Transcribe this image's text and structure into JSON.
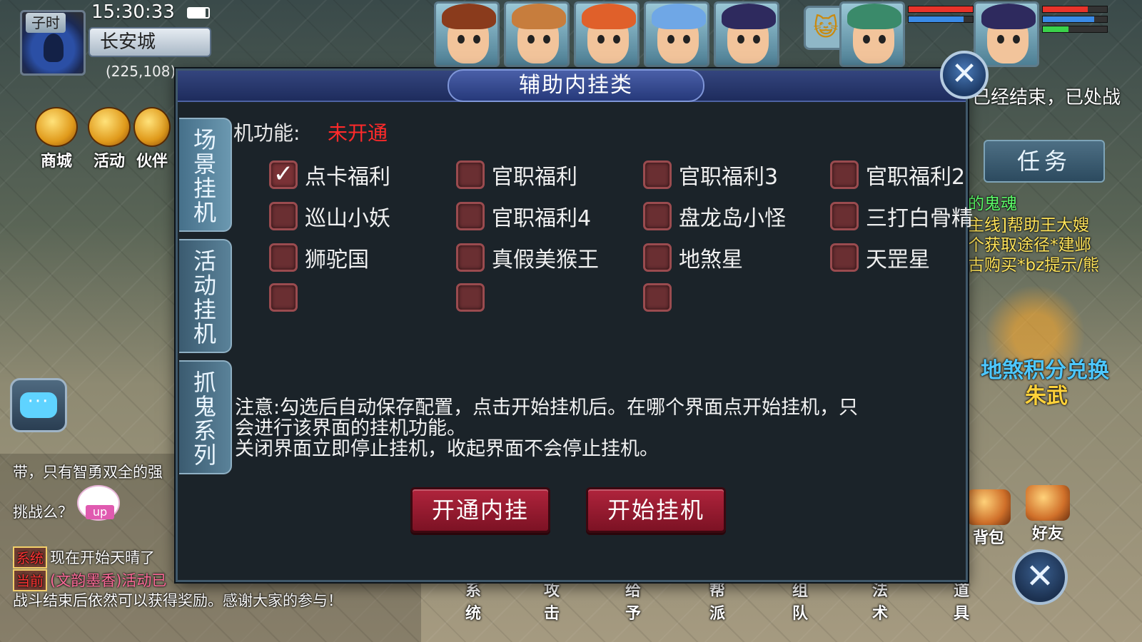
{
  "location": {
    "period": "子时",
    "time": "15:30:33",
    "city": "长安城",
    "coords": "(225,108)"
  },
  "left_icons": [
    {
      "label": "商城",
      "icon": "shop-icon"
    },
    {
      "label": "活动",
      "icon": "activity-icon"
    },
    {
      "label": "伙伴",
      "icon": "partner-icon"
    }
  ],
  "portraits": [
    {
      "icon": "character-portrait-icon",
      "hair": "#8a3b1c"
    },
    {
      "icon": "character-portrait-icon",
      "hair": "#c77d3d"
    },
    {
      "icon": "character-portrait-icon",
      "hair": "#e0602a"
    },
    {
      "icon": "character-portrait-icon",
      "hair": "#6fa7e6"
    },
    {
      "icon": "character-portrait-icon",
      "hair": "#2e2a5e"
    }
  ],
  "pet_icon": "cat-pet-icon",
  "status_portraits": [
    {
      "icon": "pet-portrait-icon",
      "hair": "#3a8a6a",
      "hp": 1.0,
      "mp": 0.85
    },
    {
      "icon": "player-portrait-icon",
      "hair": "#2e2a5e",
      "hp": 0.7,
      "mp": 0.8,
      "exp": 0.4
    }
  ],
  "chat": {
    "lines": [
      {
        "text": "带，只有智勇双全的强"
      },
      {
        "text": "挑战么？"
      },
      {
        "channel": "系统",
        "text": "现在开始天晴了"
      },
      {
        "channel": "当前",
        "text": "(文韵墨香)活动已"
      },
      {
        "text": "战斗结束后依然可以获得奖励。感谢大家的参与！"
      }
    ],
    "mascot_label": "up"
  },
  "right": {
    "top_text": "已经结束，已处战",
    "task_label": "任务",
    "lines": [
      "的鬼魂",
      "主线]帮助王大嫂",
      "个获取途径*建邺",
      "古购买*bz提示/熊"
    ],
    "reward_text": "地煞积分兑换",
    "reward_sub": "朱武",
    "side_icons": [
      {
        "label": "背包",
        "icon": "backpack-icon"
      },
      {
        "label": "好友",
        "icon": "friends-icon"
      }
    ]
  },
  "bottom_menu": [
    "系统",
    "攻击",
    "给予",
    "帮派",
    "组队",
    "法术",
    "道具"
  ],
  "dialog": {
    "title": "辅助内挂类",
    "tabs": [
      "场景挂机",
      "活动挂机",
      "抓鬼系列"
    ],
    "function_label": "机功能:",
    "function_status": "未开通",
    "options": [
      {
        "label": "点卡福利",
        "checked": true
      },
      {
        "label": "官职福利",
        "checked": false
      },
      {
        "label": "官职福利3",
        "checked": false
      },
      {
        "label": "官职福利2",
        "checked": false
      },
      {
        "label": "巡山小妖",
        "checked": false
      },
      {
        "label": "官职福利4",
        "checked": false
      },
      {
        "label": "盘龙岛小怪",
        "checked": false
      },
      {
        "label": "三打白骨精",
        "checked": false
      },
      {
        "label": "狮驼国",
        "checked": false
      },
      {
        "label": "真假美猴王",
        "checked": false
      },
      {
        "label": "地煞星",
        "checked": false
      },
      {
        "label": "天罡星",
        "checked": false
      },
      {
        "label": "",
        "checked": false
      },
      {
        "label": "",
        "checked": false
      },
      {
        "label": "",
        "checked": false
      }
    ],
    "notice": [
      "注意:勾选后自动保存配置，点击开始挂机后。在哪个界面点开始挂机，只",
      "会进行该界面的挂机功能。",
      "关闭界面立即停止挂机，收起界面不会停止挂机。"
    ],
    "open_button": "开通内挂",
    "start_button": "开始挂机",
    "accent": "#b0243c",
    "status_color": "#ff2a2a"
  }
}
